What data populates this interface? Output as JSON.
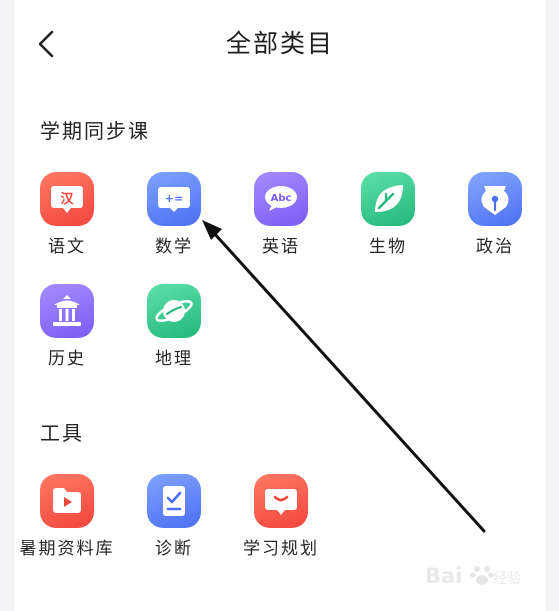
{
  "header": {
    "title": "全部类目",
    "back_icon": "chevron-left-icon"
  },
  "sections": [
    {
      "title": "学期同步课",
      "items": [
        {
          "label": "语文",
          "icon": "chinese-char-icon",
          "glyph": "汉",
          "color": "#f2453e"
        },
        {
          "label": "数学",
          "icon": "math-chat-icon",
          "glyph": "+=",
          "color": "#4b6ff2"
        },
        {
          "label": "英语",
          "icon": "english-chat-icon",
          "glyph": "Abc",
          "color": "#7a5cf2"
        },
        {
          "label": "生物",
          "icon": "leaf-icon",
          "color": "#22b77a"
        },
        {
          "label": "政治",
          "icon": "pen-nib-icon",
          "color": "#4c70f0"
        },
        {
          "label": "历史",
          "icon": "temple-icon",
          "color": "#7a5cf2"
        },
        {
          "label": "地理",
          "icon": "planet-icon",
          "color": "#22b77a"
        }
      ]
    },
    {
      "title": "工具",
      "items": [
        {
          "label": "暑期资料库",
          "icon": "video-folder-icon",
          "color": "#f2453e"
        },
        {
          "label": "诊断",
          "icon": "checklist-icon",
          "color": "#4b6ff2"
        },
        {
          "label": "学习规划",
          "icon": "chat-smile-icon",
          "color": "#f2453e"
        }
      ]
    }
  ],
  "watermark": {
    "text": "Bai",
    "sub": "经验"
  }
}
